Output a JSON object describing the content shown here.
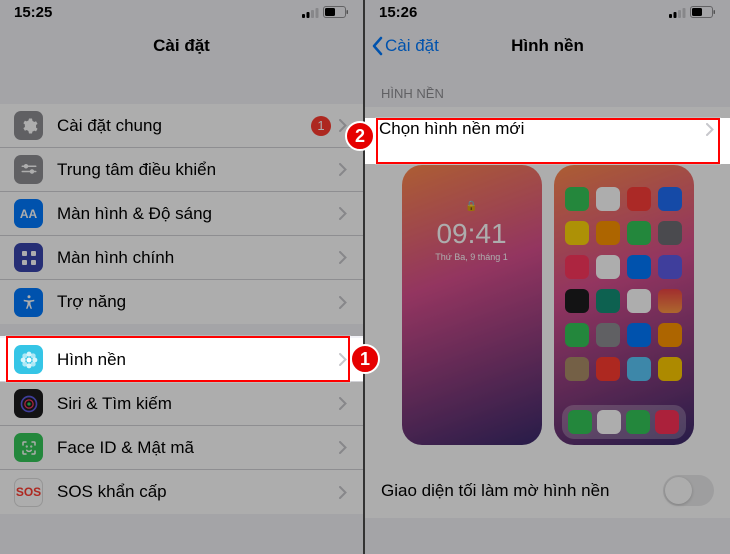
{
  "left": {
    "time": "15:25",
    "title": "Cài đặt",
    "rows": [
      {
        "label": "Cài đặt chung",
        "icon": "gear",
        "bg": "ic-gear",
        "badge": "1"
      },
      {
        "label": "Trung tâm điều khiển",
        "icon": "sliders",
        "bg": "ic-control"
      },
      {
        "label": "Màn hình & Độ sáng",
        "icon": "AA",
        "bg": "ic-display",
        "text": true
      },
      {
        "label": "Màn hình chính",
        "icon": "grid",
        "bg": "ic-home"
      },
      {
        "label": "Trợ năng",
        "icon": "person",
        "bg": "ic-access"
      },
      {
        "label": "Hình nền",
        "icon": "flower",
        "bg": "ic-wall"
      },
      {
        "label": "Siri & Tìm kiếm",
        "icon": "siri",
        "bg": "ic-siri"
      },
      {
        "label": "Face ID & Mật mã",
        "icon": "face",
        "bg": "ic-face"
      },
      {
        "label": "SOS khẩn cấp",
        "icon": "SOS",
        "bg": "ic-sos",
        "text": true
      }
    ]
  },
  "right": {
    "time": "15:26",
    "back": "Cài đặt",
    "title": "Hình nền",
    "section": "HÌNH NỀN",
    "choose": "Chọn hình nền mới",
    "lock_time": "09:41",
    "lock_date": "Thứ Ba, 9 tháng 1",
    "toggle_label": "Giao diện tối làm mờ hình nền"
  },
  "markers": {
    "one": "1",
    "two": "2"
  }
}
